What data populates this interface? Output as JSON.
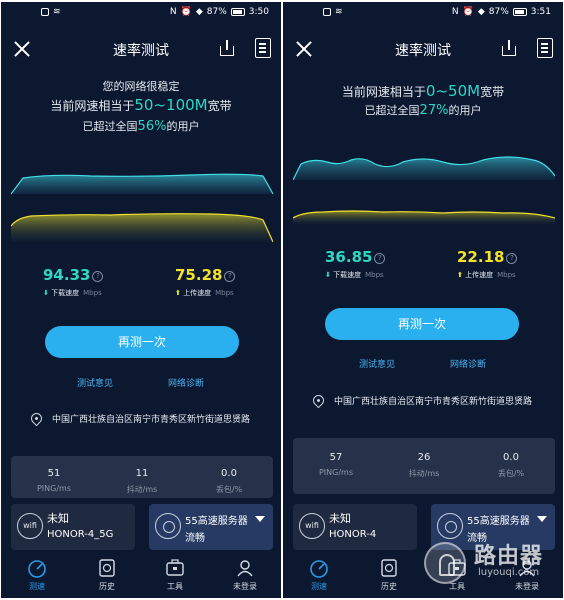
{
  "left": {
    "status": {
      "time": "3:50",
      "battery": "87%"
    },
    "title": "速率测试",
    "headline": {
      "line1": "您的网络很稳定",
      "line2_prefix": "当前网速相当于",
      "line2_highlight": "50~100M",
      "line2_suffix": "宽带",
      "line3_prefix": "已超过全国",
      "line3_highlight": "56%",
      "line3_suffix": "的用户"
    },
    "download": {
      "value": "94.33",
      "label": "下载速度",
      "unit": "Mbps"
    },
    "upload": {
      "value": "75.28",
      "label": "上传速度",
      "unit": "Mbps"
    },
    "retest_label": "再测一次",
    "link_feedback": "测试意见",
    "link_diagnose": "网络诊断",
    "location": "中国广西壮族自治区南宁市青秀区新竹街道思贤路",
    "stats": [
      {
        "value": "51",
        "label": "PING/ms"
      },
      {
        "value": "11",
        "label": "抖动/ms"
      },
      {
        "value": "0.0",
        "label": "丢包/%"
      }
    ],
    "wifi": {
      "icon_text": "wifi",
      "name": "未知",
      "ssid": "HONOR-4_5G"
    },
    "server": {
      "name": "55高速服务器",
      "status": "流畅"
    }
  },
  "right": {
    "status": {
      "time": "3:51",
      "battery": "87%"
    },
    "title": "速率测试",
    "headline": {
      "line2_prefix": "当前网速相当于",
      "line2_highlight": "0~50M",
      "line2_suffix": "宽带",
      "line3_prefix": "已超过全国",
      "line3_highlight": "27%",
      "line3_suffix": "的用户"
    },
    "download": {
      "value": "36.85",
      "label": "下载速度",
      "unit": "Mbps"
    },
    "upload": {
      "value": "22.18",
      "label": "上传速度",
      "unit": "Mbps"
    },
    "retest_label": "再测一次",
    "link_feedback": "测试意见",
    "link_diagnose": "网络诊断",
    "location": "中国广西壮族自治区南宁市青秀区新竹街道思贤路",
    "stats": [
      {
        "value": "57",
        "label": "PING/ms"
      },
      {
        "value": "26",
        "label": "抖动/ms"
      },
      {
        "value": "0.0",
        "label": "丢包/%"
      }
    ],
    "wifi": {
      "icon_text": "wifi",
      "name": "未知",
      "ssid": "HONOR-4"
    },
    "server": {
      "name": "55高速服务器",
      "status": "流畅"
    }
  },
  "tabs": [
    {
      "label": "测速",
      "icon": "speedometer-icon"
    },
    {
      "label": "历史",
      "icon": "history-icon"
    },
    {
      "label": "工具",
      "icon": "toolbox-icon"
    },
    {
      "label": "未登录",
      "icon": "user-icon"
    }
  ],
  "watermark": {
    "text": "路由器",
    "url": "luyouqi.com"
  },
  "colors": {
    "background": "#0c1830",
    "download": "#2ed9c4",
    "upload": "#f5e32a",
    "accent": "#2ab0ee",
    "link": "#4ab3f2"
  }
}
